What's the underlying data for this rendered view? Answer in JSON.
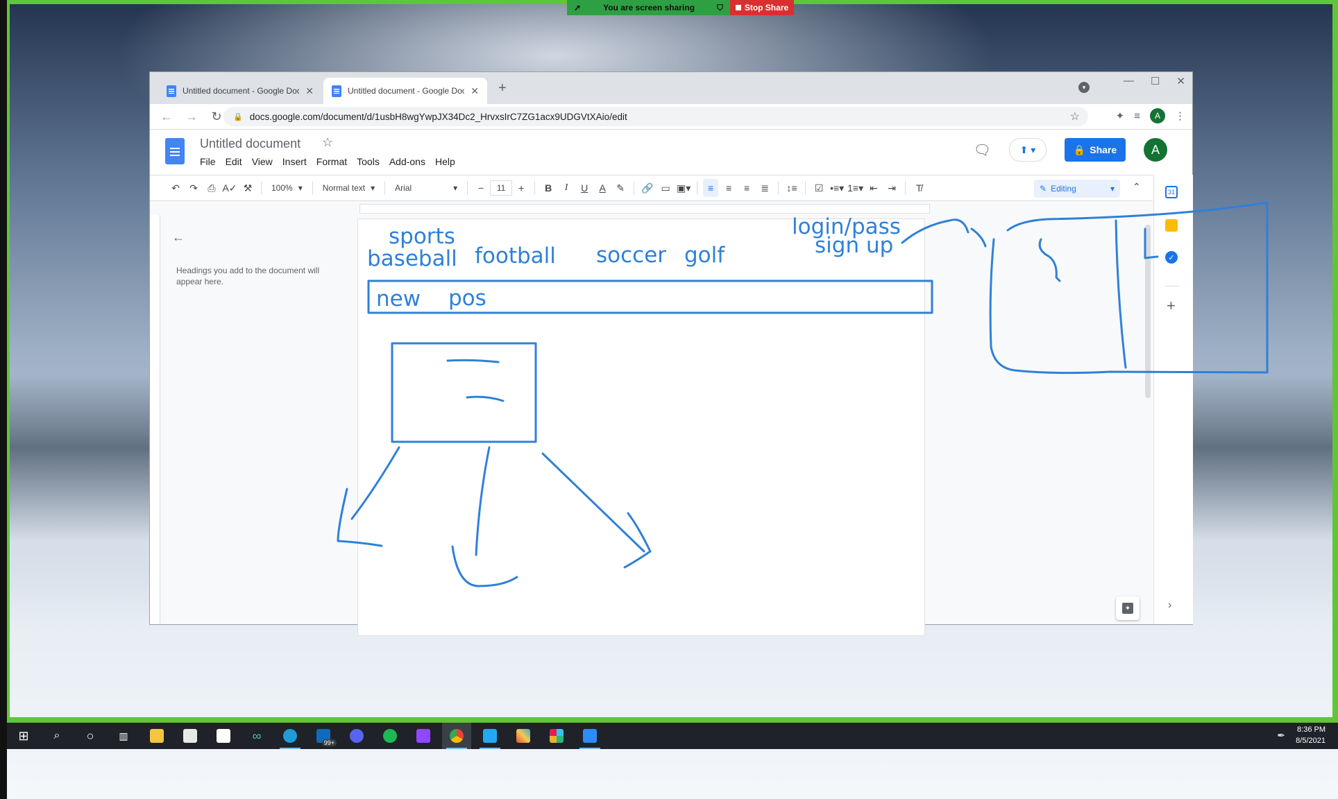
{
  "banner": {
    "sharing_text": "You are screen sharing",
    "stop_label": "Stop Share"
  },
  "browser": {
    "tabs": [
      {
        "title": "Untitled document - Google Doc"
      },
      {
        "title": "Untitled document - Google Doc"
      }
    ],
    "url": "docs.google.com/document/d/1usbH8wgYwpJX34Dc2_HrvxsIrC7ZG1acx9UDGVtXAio/edit",
    "profile_initial": "A"
  },
  "docs": {
    "title": "Untitled document",
    "menu": [
      "File",
      "Edit",
      "View",
      "Insert",
      "Format",
      "Tools",
      "Add-ons",
      "Help"
    ],
    "share_label": "Share",
    "avatar_initial": "A",
    "toolbar": {
      "zoom": "100%",
      "style": "Normal text",
      "font": "Arial",
      "font_size": "11",
      "mode": "Editing"
    },
    "outline_hint": "Headings you add to the document will appear here."
  },
  "annotations": {
    "sports": "sports",
    "baseball": "baseball",
    "football": "football",
    "soccer": "soccer",
    "golf": "golf",
    "login": "login/pass",
    "signup": "sign up",
    "new": "new",
    "pos": "pos"
  },
  "taskbar": {
    "time": "8:36 PM",
    "date": "8/5/2021",
    "mail_badge": "99+"
  },
  "colors": {
    "ink": "#2f80d8",
    "share_blue": "#1a73e8",
    "avatar_green": "#137333",
    "sharing_green": "#2ea043",
    "stop_red": "#d9302f"
  }
}
